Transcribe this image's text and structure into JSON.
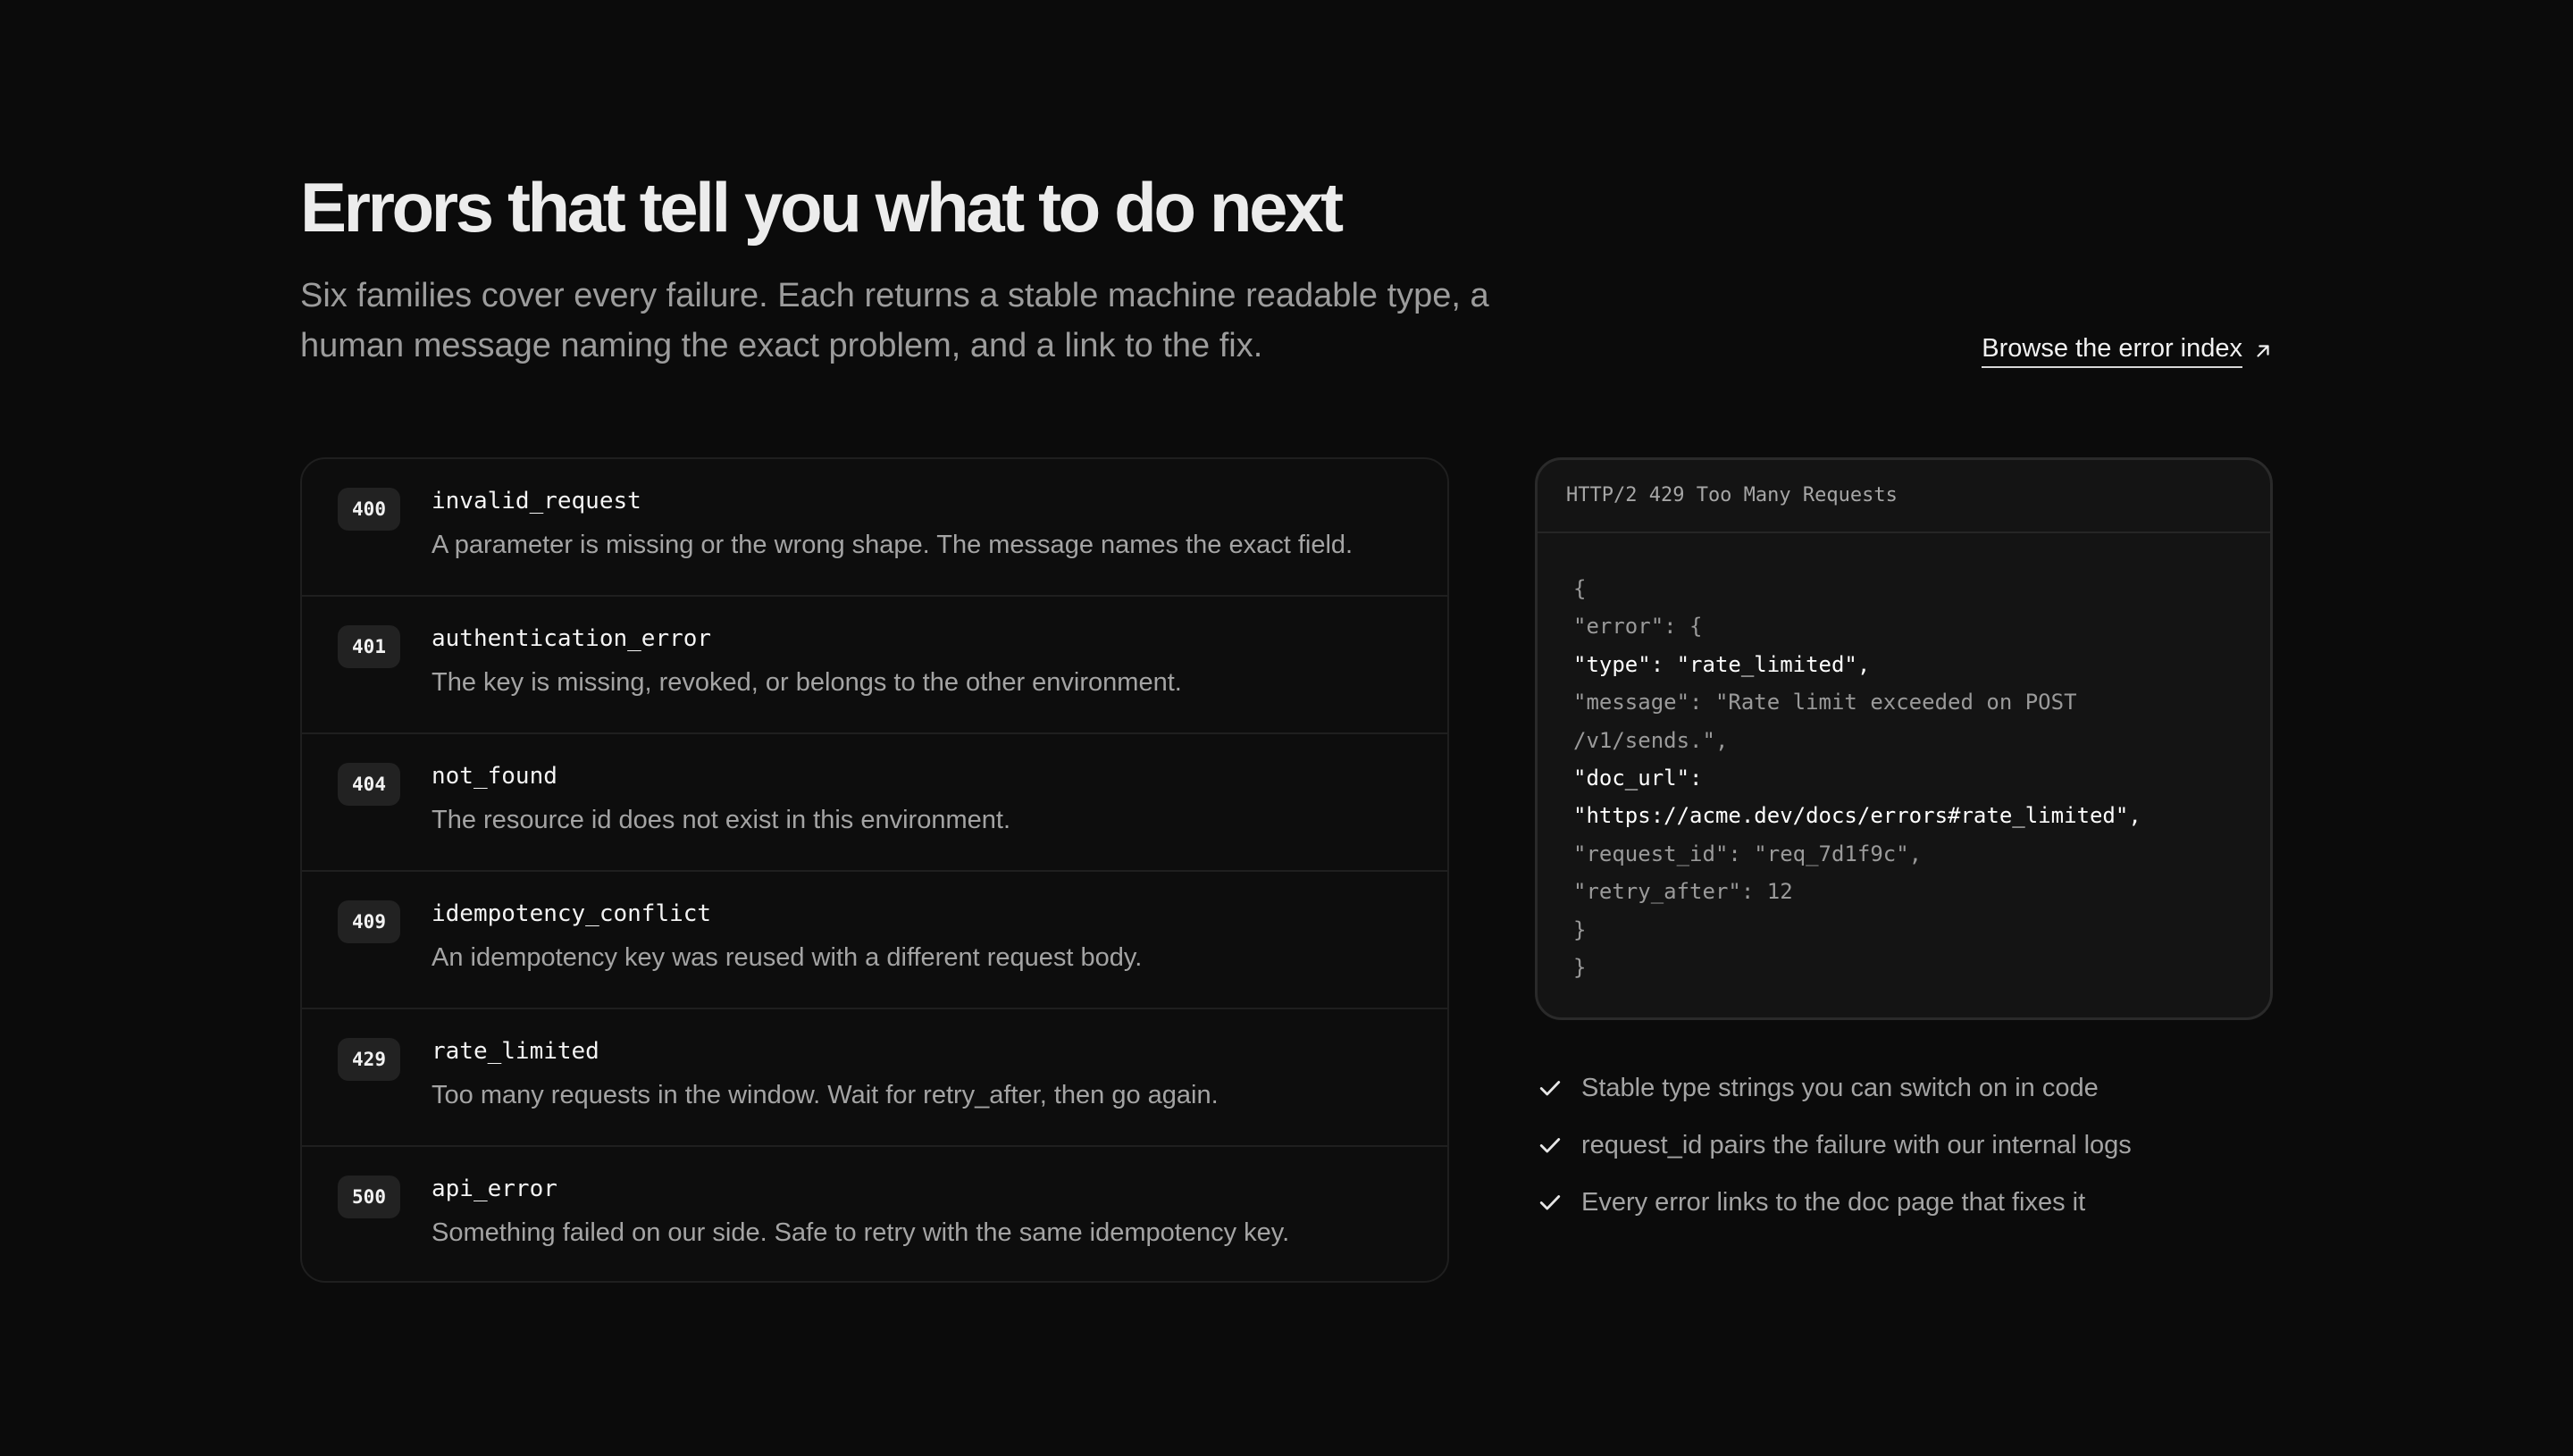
{
  "header": {
    "title": "Errors that tell you what to do next",
    "subtitle": "Six families cover every failure. Each returns a stable machine readable type, a human message naming the exact problem, and a link to the fix.",
    "link_label": "Browse the error index"
  },
  "errors": [
    {
      "code": "400",
      "type": "invalid_request",
      "description": "A parameter is missing or the wrong shape. The message names the exact field."
    },
    {
      "code": "401",
      "type": "authentication_error",
      "description": "The key is missing, revoked, or belongs to the other environment."
    },
    {
      "code": "404",
      "type": "not_found",
      "description": "The resource id does not exist in this environment."
    },
    {
      "code": "409",
      "type": "idempotency_conflict",
      "description": "An idempotency key was reused with a different request body."
    },
    {
      "code": "429",
      "type": "rate_limited",
      "description": "Too many requests in the window. Wait for retry_after, then go again."
    },
    {
      "code": "500",
      "type": "api_error",
      "description": "Something failed on our side. Safe to retry with the same idempotency key."
    }
  ],
  "code_panel": {
    "header": "HTTP/2 429 Too Many Requests",
    "lines": [
      "{",
      "\"error\": {",
      "\"type\": \"rate_limited\",",
      "\"message\": \"Rate limit exceeded on POST",
      "/v1/sends.\",",
      "\"doc_url\":",
      "\"https://acme.dev/docs/errors#rate_limited\",",
      "\"request_id\": \"req_7d1f9c\",",
      "\"retry_after\": 12",
      "}",
      "}"
    ]
  },
  "features": [
    "Stable type strings you can switch on in code",
    "request_id pairs the failure with our internal logs",
    "Every error links to the doc page that fixes it"
  ],
  "icons": {
    "link": "arrow-up-right-icon",
    "feature": "check-icon"
  },
  "colors": {
    "background": "#0b0b0b",
    "heading": "#ececec",
    "muted": "#9c9c9c",
    "badge": "#222222",
    "panel": "#141414"
  }
}
